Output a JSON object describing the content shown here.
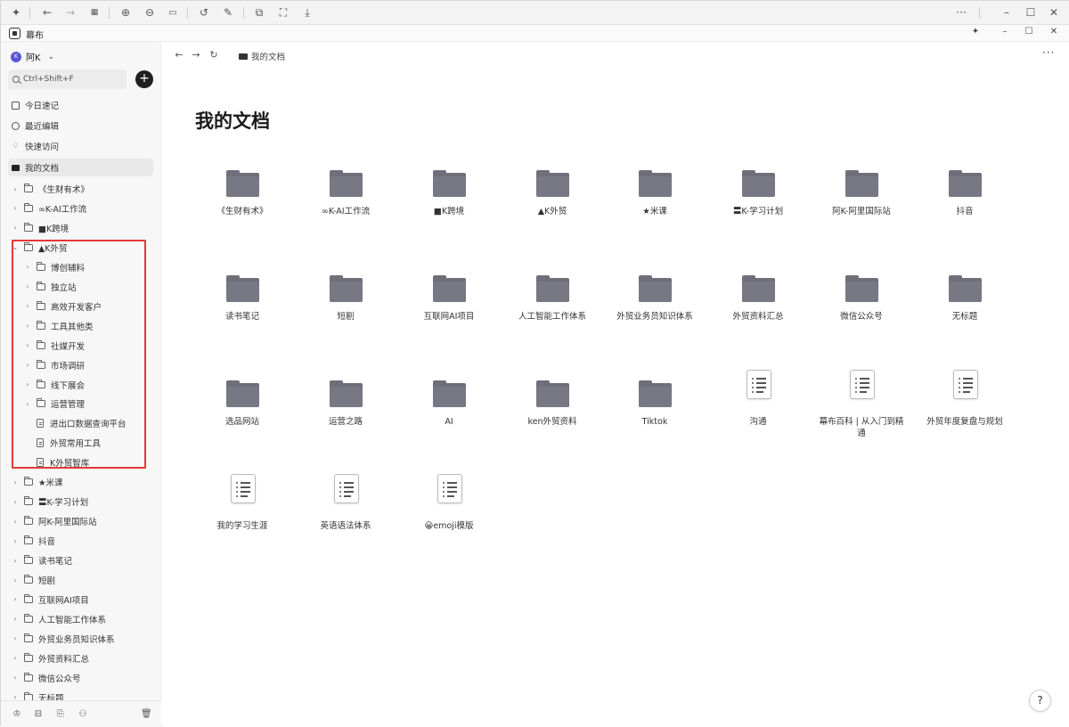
{
  "app": {
    "title": "幕布"
  },
  "titlebar_controls": [
    "pin-icon",
    "minimize-icon",
    "maximize-icon",
    "close-icon"
  ],
  "user": {
    "avatar_initial": "K",
    "name": "阿K"
  },
  "search": {
    "placeholder": "Ctrl+Shift+F"
  },
  "add_button": "+",
  "nav": [
    {
      "label": "今日速记",
      "icon": "calendar-icon"
    },
    {
      "label": "最近编辑",
      "icon": "clock-icon"
    },
    {
      "label": "快速访问",
      "icon": "lightbulb-icon"
    },
    {
      "label": "我的文档",
      "icon": "folder-icon",
      "active": true
    }
  ],
  "tree": [
    {
      "label": "《生财有术》",
      "type": "folder",
      "level": 0,
      "expanded": false
    },
    {
      "label": "∞K-AI工作流",
      "type": "folder",
      "level": 0,
      "expanded": false
    },
    {
      "label": "■K跨境",
      "type": "folder",
      "level": 0,
      "expanded": false
    },
    {
      "label": "▲K外贸",
      "type": "folder",
      "level": 0,
      "expanded": true
    },
    {
      "label": "博创辅料",
      "type": "folder",
      "level": 1,
      "expanded": false
    },
    {
      "label": "独立站",
      "type": "folder",
      "level": 1,
      "expanded": false
    },
    {
      "label": "高效开发客户",
      "type": "folder",
      "level": 1,
      "expanded": false
    },
    {
      "label": "工具其他类",
      "type": "folder",
      "level": 1,
      "expanded": false
    },
    {
      "label": "社媒开发",
      "type": "folder",
      "level": 1,
      "expanded": false
    },
    {
      "label": "市场调研",
      "type": "folder",
      "level": 1,
      "expanded": false
    },
    {
      "label": "线下展会",
      "type": "folder",
      "level": 1,
      "expanded": false
    },
    {
      "label": "运营管理",
      "type": "folder",
      "level": 1,
      "expanded": false
    },
    {
      "label": "进出口数据查询平台",
      "type": "doc",
      "level": 1
    },
    {
      "label": "外贸常用工具",
      "type": "doc",
      "level": 1
    },
    {
      "label": "K外贸智库",
      "type": "doc",
      "level": 1
    },
    {
      "label": "★米课",
      "type": "folder",
      "level": 0,
      "expanded": false
    },
    {
      "label": "〓K-学习计划",
      "type": "folder",
      "level": 0,
      "expanded": false
    },
    {
      "label": "阿K-阿里国际站",
      "type": "folder",
      "level": 0,
      "expanded": false
    },
    {
      "label": "抖音",
      "type": "folder",
      "level": 0,
      "expanded": false
    },
    {
      "label": "读书笔记",
      "type": "folder",
      "level": 0,
      "expanded": false
    },
    {
      "label": "短剧",
      "type": "folder",
      "level": 0,
      "expanded": false
    },
    {
      "label": "互联网AI项目",
      "type": "folder",
      "level": 0,
      "expanded": false
    },
    {
      "label": "人工智能工作体系",
      "type": "folder",
      "level": 0,
      "expanded": false
    },
    {
      "label": "外贸业务员知识体系",
      "type": "folder",
      "level": 0,
      "expanded": false
    },
    {
      "label": "外贸资料汇总",
      "type": "folder",
      "level": 0,
      "expanded": false
    },
    {
      "label": "微信公众号",
      "type": "folder",
      "level": 0,
      "expanded": false
    },
    {
      "label": "无标题",
      "type": "folder",
      "level": 0,
      "expanded": false
    }
  ],
  "breadcrumb": {
    "label": "我的文档"
  },
  "main": {
    "title": "我的文档",
    "items": [
      {
        "label": "《生财有术》",
        "type": "folder"
      },
      {
        "label": "∞K-AI工作流",
        "type": "folder"
      },
      {
        "label": "■K跨境",
        "type": "folder"
      },
      {
        "label": "▲K外贸",
        "type": "folder"
      },
      {
        "label": "★米课",
        "type": "folder"
      },
      {
        "label": "〓K-学习计划",
        "type": "folder"
      },
      {
        "label": "阿K-阿里国际站",
        "type": "folder"
      },
      {
        "label": "抖音",
        "type": "folder"
      },
      {
        "label": "读书笔记",
        "type": "folder"
      },
      {
        "label": "短剧",
        "type": "folder"
      },
      {
        "label": "互联网AI项目",
        "type": "folder"
      },
      {
        "label": "人工智能工作体系",
        "type": "folder"
      },
      {
        "label": "外贸业务员知识体系",
        "type": "folder"
      },
      {
        "label": "外贸资料汇总",
        "type": "folder"
      },
      {
        "label": "微信公众号",
        "type": "folder"
      },
      {
        "label": "无标题",
        "type": "folder"
      },
      {
        "label": "选品网站",
        "type": "folder"
      },
      {
        "label": "运营之路",
        "type": "folder"
      },
      {
        "label": "AI",
        "type": "folder"
      },
      {
        "label": "ken外贸资料",
        "type": "folder"
      },
      {
        "label": "Tiktok",
        "type": "folder"
      },
      {
        "label": "沟通",
        "type": "doc"
      },
      {
        "label": "幕布百科 | 从入门到精通",
        "type": "doc"
      },
      {
        "label": "外贸年度复盘与规划",
        "type": "doc"
      },
      {
        "label": "我的学习生涯",
        "type": "doc"
      },
      {
        "label": "英语语法体系",
        "type": "doc"
      },
      {
        "label": "😀emoji模版",
        "type": "doc"
      }
    ]
  },
  "help": "?"
}
